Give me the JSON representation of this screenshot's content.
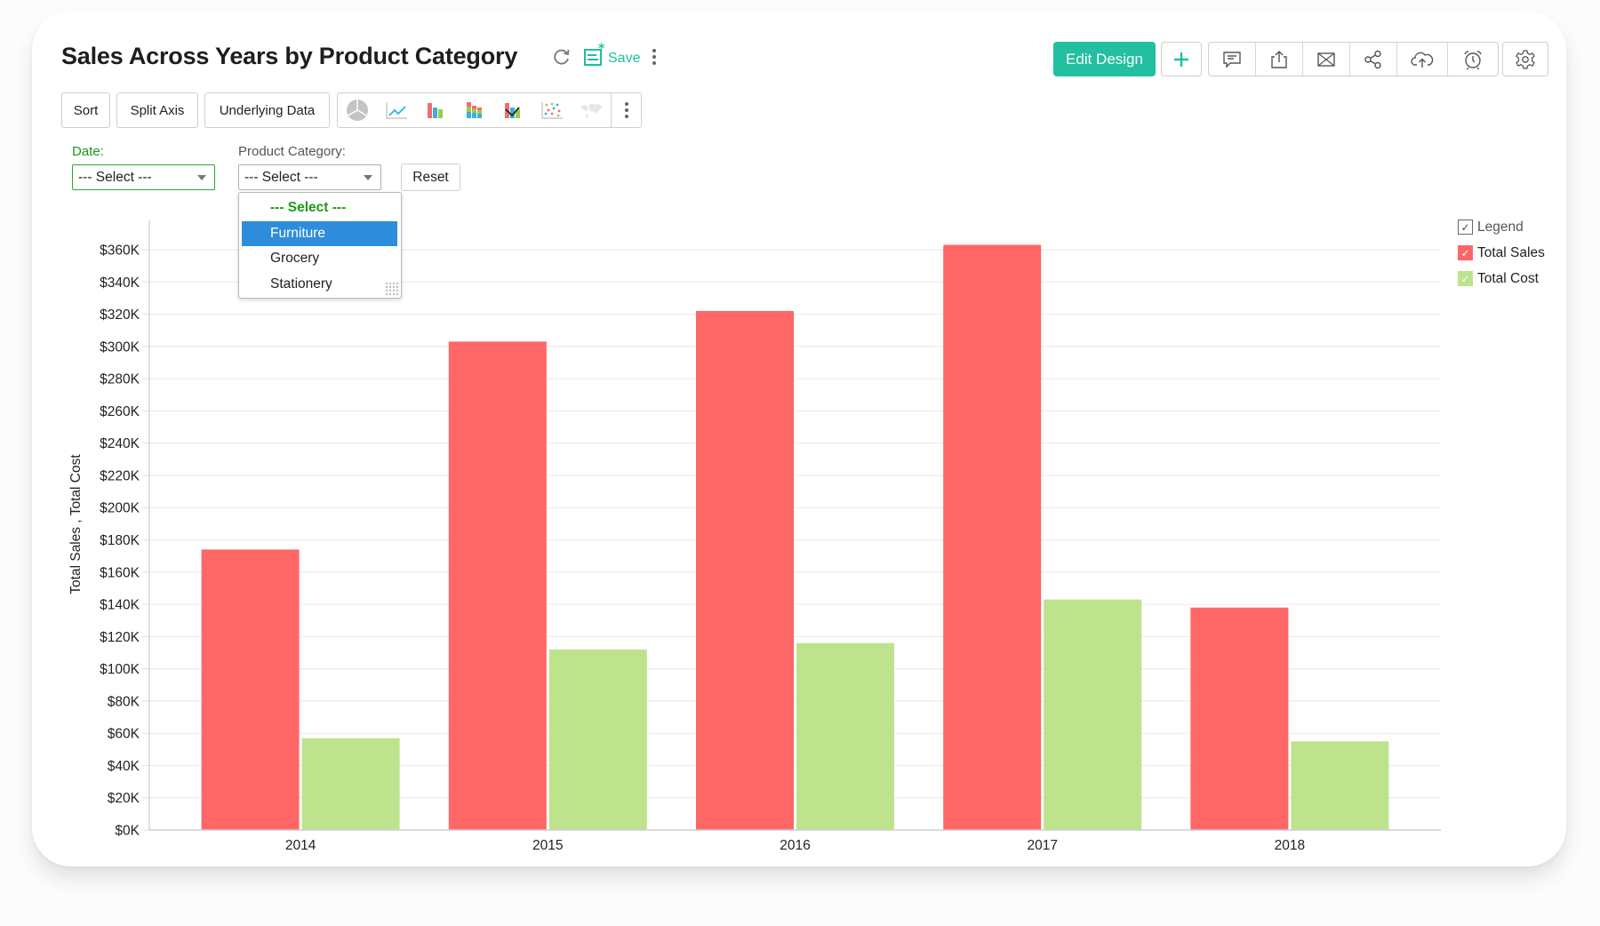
{
  "header": {
    "title": "Sales Across Years by Product Category",
    "refresh_icon": "refresh-icon",
    "save_label": "Save",
    "more_icon": "vertical-ellipsis-icon"
  },
  "toolbar": {
    "sort_label": "Sort",
    "split_axis_label": "Split Axis",
    "underlying_data_label": "Underlying Data",
    "chart_types": [
      "pie-chart-icon",
      "line-chart-icon",
      "bar-chart-icon",
      "stacked-bar-chart-icon",
      "combination-chart-icon",
      "scatter-chart-icon",
      "map-chart-icon"
    ],
    "more_icon": "vertical-ellipsis-icon"
  },
  "actions": {
    "edit_design_label": "Edit Design",
    "add_icon": "plus-icon",
    "tools": [
      "comment-icon",
      "export-icon",
      "email-icon",
      "share-icon",
      "cloud-upload-icon",
      "alarm-icon"
    ],
    "settings_icon": "gear-icon"
  },
  "filters": {
    "date": {
      "label": "Date:",
      "value": "--- Select ---"
    },
    "product_category": {
      "label": "Product Category:",
      "value": "--- Select ---",
      "options": [
        "--- Select ---",
        "Furniture",
        "Grocery",
        "Stationery"
      ],
      "highlighted": "Furniture"
    },
    "reset_label": "Reset"
  },
  "colors": {
    "accent": "#22bfa1",
    "total_sales": "#ff6666",
    "total_cost": "#bde38d",
    "dropdown_highlight": "#2e8ddb",
    "filter_active": "#1a9a1a"
  },
  "legend": {
    "title": "Legend",
    "items": [
      {
        "name": "Total Sales",
        "checked": true
      },
      {
        "name": "Total Cost",
        "checked": true
      }
    ]
  },
  "chart_data": {
    "type": "bar",
    "title": "Sales Across Years by Product Category",
    "xlabel": "",
    "ylabel": "Total Sales , Total Cost",
    "categories": [
      "2014",
      "2015",
      "2016",
      "2017",
      "2018"
    ],
    "series": [
      {
        "name": "Total Sales",
        "color": "#ff6666",
        "values": [
          174000,
          303000,
          322000,
          363000,
          138000
        ]
      },
      {
        "name": "Total Cost",
        "color": "#bde38d",
        "values": [
          57000,
          112000,
          116000,
          143000,
          55000
        ]
      }
    ],
    "ylim": [
      0,
      360000
    ],
    "yticks": [
      0,
      20000,
      40000,
      60000,
      80000,
      100000,
      120000,
      140000,
      160000,
      180000,
      200000,
      220000,
      240000,
      260000,
      280000,
      300000,
      320000,
      340000,
      360000
    ],
    "ytick_labels": [
      "$0K",
      "$20K",
      "$40K",
      "$60K",
      "$80K",
      "$100K",
      "$120K",
      "$140K",
      "$160K",
      "$180K",
      "$200K",
      "$220K",
      "$240K",
      "$260K",
      "$280K",
      "$300K",
      "$320K",
      "$340K",
      "$360K"
    ],
    "grid": true,
    "legend_position": "top-right"
  }
}
